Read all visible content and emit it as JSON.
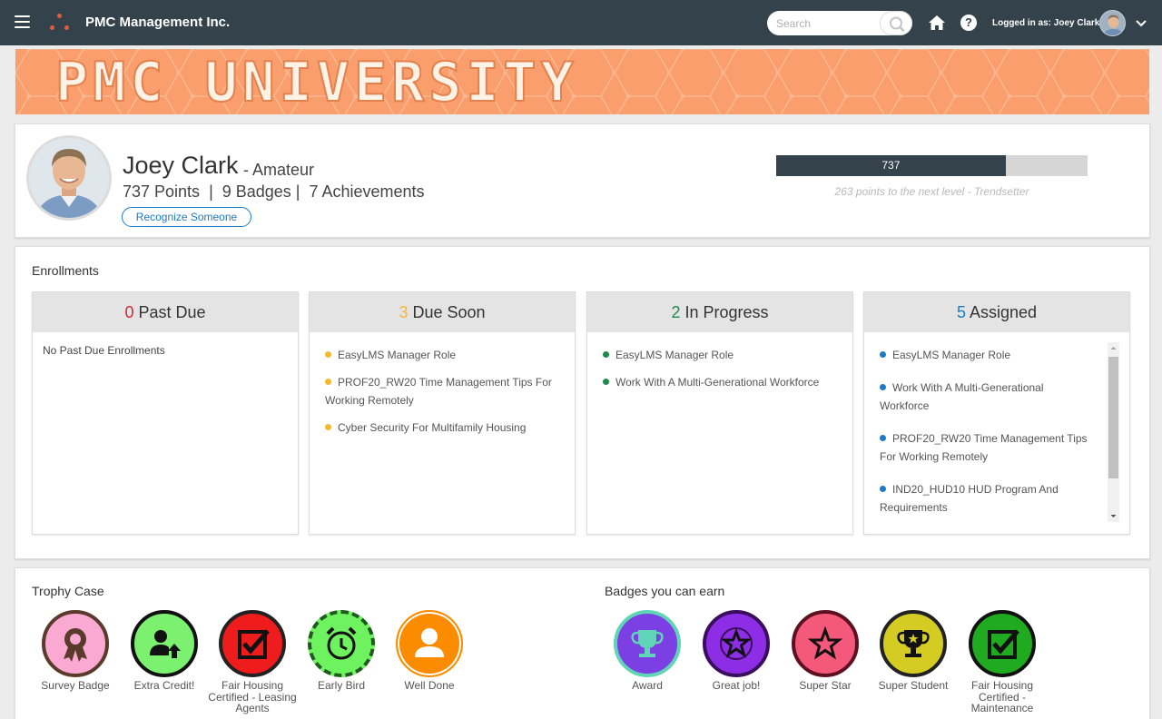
{
  "header": {
    "company": "PMC Management Inc.",
    "search_placeholder": "Search",
    "logged_in": "Logged in as: Joey Clark"
  },
  "banner": {
    "title": "PMC UNIVERSITY"
  },
  "profile": {
    "name": "Joey Clark",
    "level": "- Amateur",
    "stats": "737 Points  |  9 Badges |  7 Achievements",
    "recognize_label": "Recognize Someone",
    "points": 737,
    "points_label": "737",
    "points_max": 1000,
    "next_level_note": "263 points to the next level - Trendsetter"
  },
  "enrollments": {
    "title": "Enrollments",
    "columns": [
      {
        "count": "0",
        "label": "Past Due",
        "color": "#d9262b",
        "empty": "No Past Due Enrollments",
        "items": []
      },
      {
        "count": "3",
        "label": "Due Soon",
        "color": "#f5b82e",
        "items": [
          "EasyLMS Manager Role",
          "PROF20_RW20 Time Management Tips For Working Remotely",
          "Cyber Security For Multifamily Housing"
        ]
      },
      {
        "count": "2",
        "label": "In Progress",
        "color": "#1f8a4c",
        "items": [
          "EasyLMS Manager Role",
          "Work With A Multi-Generational Workforce"
        ]
      },
      {
        "count": "5",
        "label": "Assigned",
        "color": "#1b7bc4",
        "items": [
          "EasyLMS Manager Role",
          "Work With A Multi-Generational Workforce",
          "PROF20_RW20 Time Management Tips For Working Remotely",
          "IND20_HUD10 HUD Program And Requirements"
        ]
      }
    ]
  },
  "trophy_case": {
    "title": "Trophy Case",
    "badges": [
      {
        "label": "Survey Badge",
        "icon": "ribbon-icon",
        "fill": "#f9a9d2",
        "ring": "#5a3a2a"
      },
      {
        "label": "Extra Credit!",
        "icon": "person-up-icon",
        "fill": "#7cf06f",
        "ring": "#111111"
      },
      {
        "label": "Fair Housing Certified - Leasing Agents",
        "icon": "checkbox-icon",
        "fill": "#ee1c1c",
        "ring": "#222222"
      },
      {
        "label": "Early Bird",
        "icon": "alarm-clock-icon",
        "fill": "#6ef25f",
        "ring": "#1f5a1f"
      },
      {
        "label": "Well Done",
        "icon": "person-icon",
        "fill": "#fb8c00",
        "ring": "#fb8c00"
      }
    ]
  },
  "badges_to_earn": {
    "title": "Badges you can earn",
    "badges": [
      {
        "label": "Award",
        "icon": "trophy-icon",
        "fill": "#7c3fe4",
        "ring": "#5fd4b6"
      },
      {
        "label": "Great job!",
        "icon": "star-icon",
        "fill": "#8d2ee6",
        "ring": "#3a0d5e"
      },
      {
        "label": "Super Star",
        "icon": "star-icon",
        "fill": "#f4587a",
        "ring": "#5c1020"
      },
      {
        "label": "Super Student",
        "icon": "trophy-icon",
        "fill": "#d4cc22",
        "ring": "#222222"
      },
      {
        "label": "Fair Housing Certified - Maintenance",
        "icon": "checkbox-icon",
        "fill": "#1faa1f",
        "ring": "#111111"
      }
    ]
  }
}
